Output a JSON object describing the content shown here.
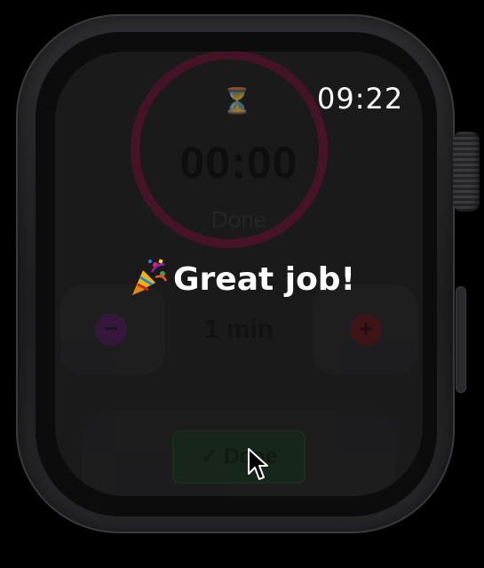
{
  "status_bar": {
    "time": "09:22"
  },
  "background_timer": {
    "timer_icon": "timer-icon",
    "time_remaining": "00:00",
    "status": "Done",
    "duration": "1 min",
    "minus_label": "−",
    "plus_label": "+",
    "done_button_label": "✓ Done",
    "ring_color": "#c2185b",
    "minus_color": "#9c27b0",
    "plus_color": "#b71c1c",
    "done_color": "#2e7d32"
  },
  "toast": {
    "icon": "party-popper-icon",
    "message": "Great job!"
  },
  "cursor": {
    "icon": "mouse-pointer-icon"
  }
}
